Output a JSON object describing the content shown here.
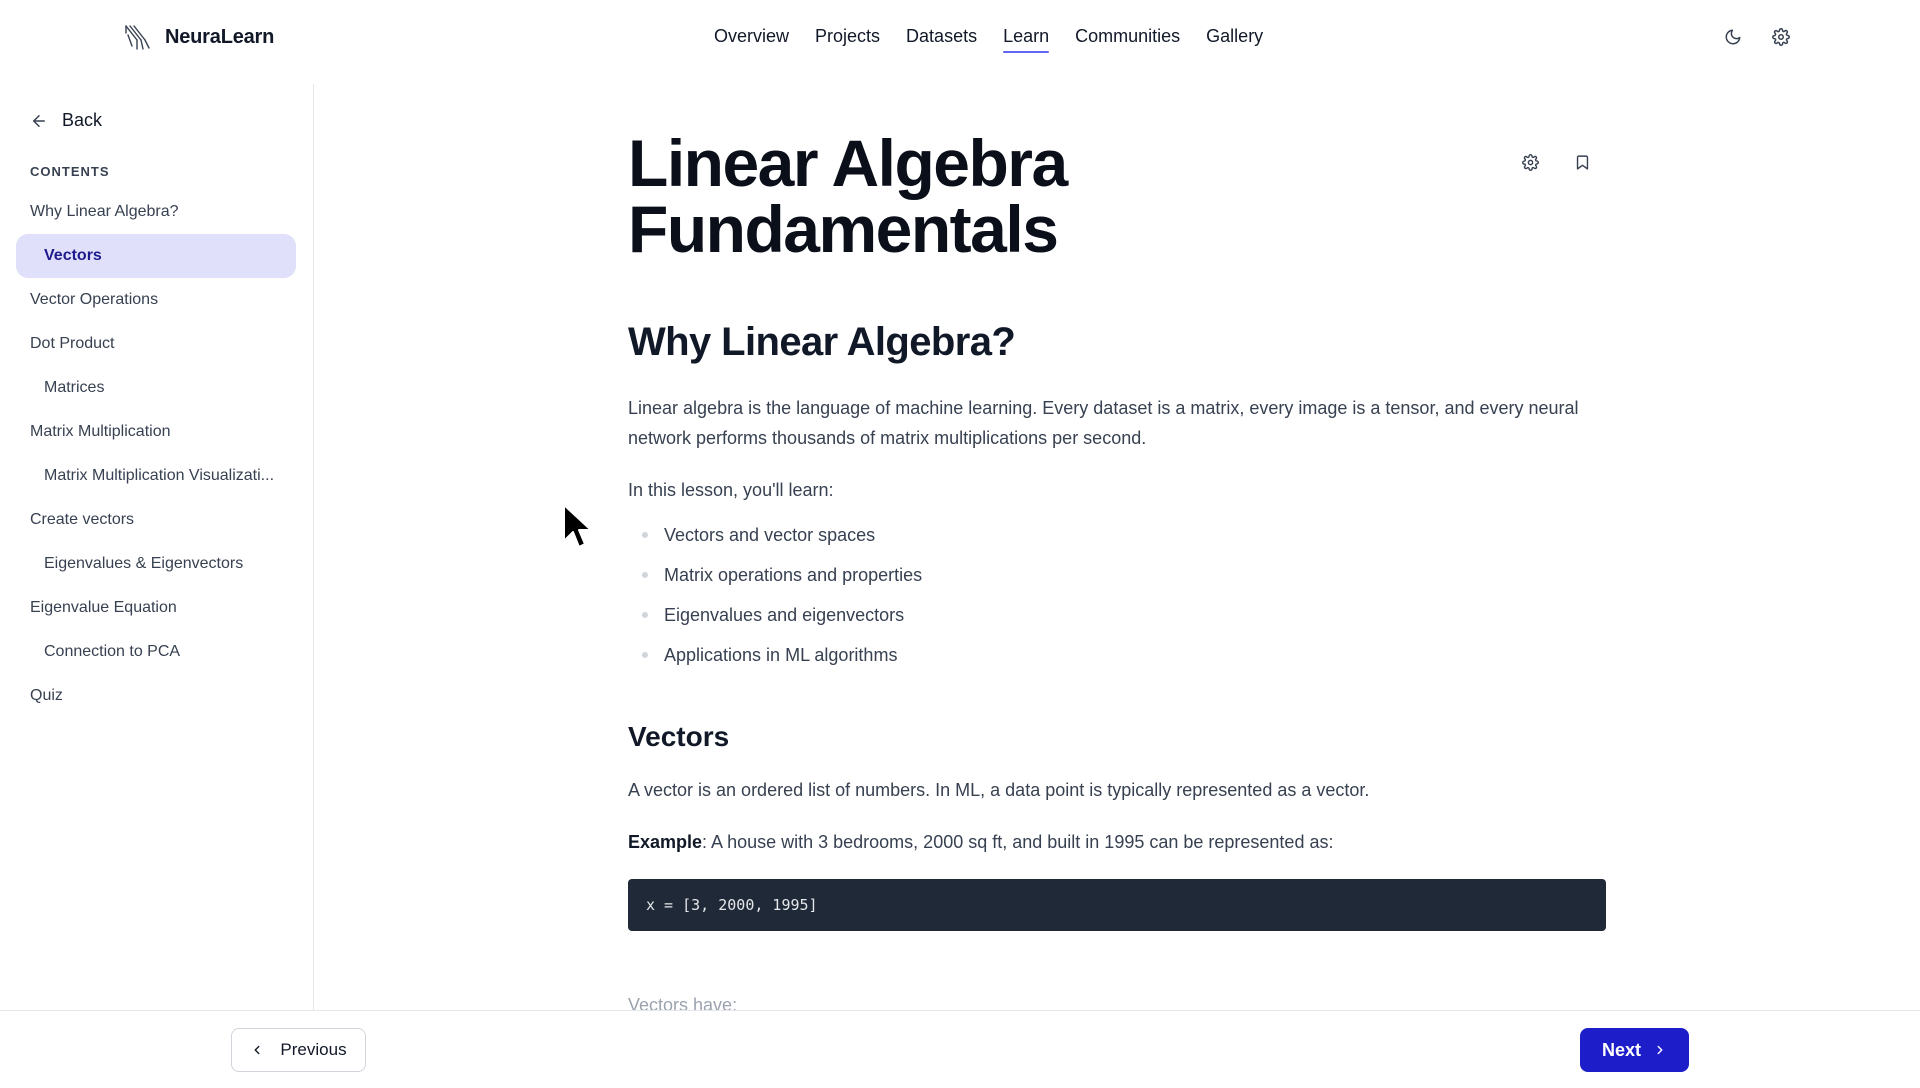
{
  "header": {
    "brand": "NeuraLearn",
    "nav": [
      "Overview",
      "Projects",
      "Datasets",
      "Learn",
      "Communities",
      "Gallery"
    ],
    "active_nav": "Learn",
    "icons": [
      "moon-icon",
      "gear-icon"
    ]
  },
  "sidebar": {
    "back_label": "Back",
    "contents_title": "CONTENTS",
    "items": [
      {
        "label": "Why Linear Algebra?",
        "level": 1
      },
      {
        "label": "Vectors",
        "level": 2,
        "active": true
      },
      {
        "label": "Vector Operations",
        "level": 1
      },
      {
        "label": "Dot Product",
        "level": 1
      },
      {
        "label": "Matrices",
        "level": 2
      },
      {
        "label": "Matrix Multiplication",
        "level": 1
      },
      {
        "label": "Matrix Multiplication Visualizati...",
        "level": 2
      },
      {
        "label": "Create vectors",
        "level": 1
      },
      {
        "label": "Eigenvalues & Eigenvectors",
        "level": 2
      },
      {
        "label": "Eigenvalue Equation",
        "level": 1
      },
      {
        "label": "Connection to PCA",
        "level": 2
      },
      {
        "label": "Quiz",
        "level": 1
      }
    ]
  },
  "main": {
    "title_line1": "Linear Algebra",
    "title_line2": "Fundamentals",
    "title_icons": [
      "gear-icon",
      "bookmark-icon"
    ],
    "section1_heading": "Why Linear Algebra?",
    "section1_para": "Linear algebra is the language of machine learning. Every dataset is a matrix, every image is a tensor, and every neural network performs thousands of matrix multiplications per second.",
    "lesson_intro": "In this lesson, you'll learn:",
    "bullets": [
      "Vectors and vector spaces",
      "Matrix operations and properties",
      "Eigenvalues and eigenvectors",
      "Applications in ML algorithms"
    ],
    "section2_heading": "Vectors",
    "section2_para": "A vector is an ordered list of numbers. In ML, a data point is typically represented as a vector.",
    "example_label": "Example",
    "example_text": ": A house with 3 bedrooms, 2000 sq ft, and built in 1995 can be represented as:",
    "code": "x = [3, 2000, 1995]",
    "partial_text": "Vectors have:"
  },
  "footer": {
    "prev_label": "Previous",
    "next_label": "Next"
  },
  "colors": {
    "accent": "#1d1dc9",
    "active_bg": "#e0e0fb",
    "underline": "#6366f1",
    "code_bg": "#1f2937"
  }
}
